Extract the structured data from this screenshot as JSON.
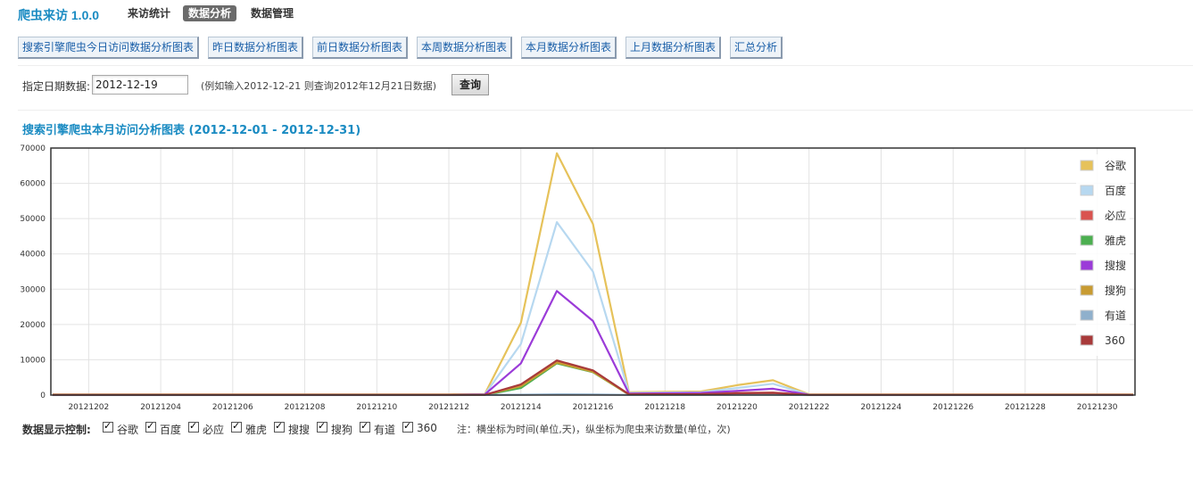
{
  "app": {
    "brand": "爬虫来访 1.0.0",
    "nav": [
      {
        "label": "来访统计",
        "active": false
      },
      {
        "label": "数据分析",
        "active": true
      },
      {
        "label": "数据管理",
        "active": false
      }
    ]
  },
  "report_buttons": [
    "搜索引擎爬虫今日访问数据分析图表",
    "昨日数据分析图表",
    "前日数据分析图表",
    "本周数据分析图表",
    "本月数据分析图表",
    "上月数据分析图表",
    "汇总分析"
  ],
  "date_query": {
    "label": "指定日期数据:",
    "value": "2012-12-19",
    "hint": "(例如输入2012-12-21 则查询2012年12月21日数据)",
    "button": "查询"
  },
  "chart_title": "搜索引擎爬虫本月访问分析图表 (2012-12-01 - 2012-12-31)",
  "chart_data": {
    "type": "line",
    "title": "搜索引擎爬虫本月访问分析图表 (2012-12-01 - 2012-12-31)",
    "x": [
      "20121201",
      "20121202",
      "20121203",
      "20121204",
      "20121205",
      "20121206",
      "20121207",
      "20121208",
      "20121209",
      "20121210",
      "20121211",
      "20121212",
      "20121213",
      "20121214",
      "20121215",
      "20121216",
      "20121217",
      "20121218",
      "20121219",
      "20121220",
      "20121221",
      "20121222",
      "20121223",
      "20121224",
      "20121225",
      "20121226",
      "20121227",
      "20121228",
      "20121229",
      "20121230",
      "20121231"
    ],
    "x_tick_labels": [
      "20121202",
      "20121204",
      "20121206",
      "20121208",
      "20121210",
      "20121212",
      "20121214",
      "20121216",
      "20121218",
      "20121220",
      "20121222",
      "20121224",
      "20121226",
      "20121228",
      "20121230"
    ],
    "y_ticks": [
      0,
      10000,
      20000,
      30000,
      40000,
      50000,
      60000,
      70000
    ],
    "ylim": [
      0,
      70000
    ],
    "grid": true,
    "legend_position": "top-right",
    "series": [
      {
        "name": "谷歌",
        "color": "#e6c25a",
        "values": [
          200,
          200,
          200,
          200,
          200,
          200,
          200,
          200,
          200,
          200,
          200,
          200,
          300,
          20500,
          68500,
          48500,
          800,
          900,
          1000,
          2800,
          4200,
          200,
          200,
          200,
          200,
          200,
          200,
          200,
          200,
          200,
          200
        ]
      },
      {
        "name": "百度",
        "color": "#b7d8f0",
        "values": [
          100,
          100,
          100,
          100,
          100,
          100,
          100,
          100,
          100,
          100,
          100,
          100,
          200,
          14500,
          49000,
          35000,
          600,
          700,
          800,
          2000,
          3200,
          100,
          100,
          100,
          100,
          100,
          100,
          100,
          100,
          100,
          100
        ]
      },
      {
        "name": "必应",
        "color": "#d9534f",
        "values": [
          50,
          50,
          50,
          50,
          50,
          50,
          50,
          50,
          50,
          50,
          50,
          50,
          80,
          2800,
          9500,
          6800,
          200,
          250,
          300,
          600,
          700,
          50,
          50,
          50,
          50,
          50,
          50,
          50,
          50,
          50,
          50
        ]
      },
      {
        "name": "雅虎",
        "color": "#4caf50",
        "values": [
          20,
          20,
          20,
          20,
          20,
          20,
          20,
          20,
          20,
          20,
          20,
          20,
          30,
          2000,
          9000,
          6500,
          150,
          180,
          200,
          400,
          500,
          20,
          20,
          20,
          20,
          20,
          20,
          20,
          20,
          20,
          20
        ]
      },
      {
        "name": "搜搜",
        "color": "#9b3bd8",
        "values": [
          100,
          100,
          100,
          100,
          100,
          100,
          100,
          100,
          100,
          100,
          100,
          100,
          200,
          9000,
          29500,
          21000,
          400,
          500,
          600,
          1200,
          1800,
          100,
          100,
          100,
          100,
          100,
          100,
          100,
          100,
          100,
          100
        ]
      },
      {
        "name": "搜狗",
        "color": "#c89b32",
        "values": [
          30,
          30,
          30,
          30,
          30,
          30,
          30,
          30,
          30,
          30,
          30,
          30,
          50,
          2500,
          9200,
          6600,
          150,
          180,
          200,
          400,
          500,
          30,
          30,
          30,
          30,
          30,
          30,
          30,
          30,
          30,
          30
        ]
      },
      {
        "name": "有道",
        "color": "#8fb0cc",
        "values": [
          10,
          10,
          10,
          10,
          10,
          10,
          10,
          10,
          10,
          10,
          10,
          10,
          20,
          100,
          200,
          150,
          50,
          50,
          50,
          80,
          80,
          10,
          10,
          10,
          10,
          10,
          10,
          10,
          10,
          10,
          10
        ]
      },
      {
        "name": "360",
        "color": "#a83a3a",
        "values": [
          40,
          40,
          40,
          40,
          40,
          40,
          40,
          40,
          40,
          40,
          40,
          40,
          60,
          3000,
          9800,
          7000,
          200,
          220,
          250,
          500,
          600,
          40,
          40,
          40,
          40,
          40,
          40,
          40,
          40,
          40,
          40
        ]
      }
    ]
  },
  "controls": {
    "title": "数据显示控制:",
    "items": [
      {
        "label": "谷歌",
        "checked": true
      },
      {
        "label": "百度",
        "checked": true
      },
      {
        "label": "必应",
        "checked": true
      },
      {
        "label": "雅虎",
        "checked": true
      },
      {
        "label": "搜搜",
        "checked": true
      },
      {
        "label": "搜狗",
        "checked": true
      },
      {
        "label": "有道",
        "checked": true
      },
      {
        "label": "360",
        "checked": true
      }
    ],
    "note": "注：横坐标为时间(单位,天)，纵坐标为爬虫来访数量(单位，次)"
  }
}
